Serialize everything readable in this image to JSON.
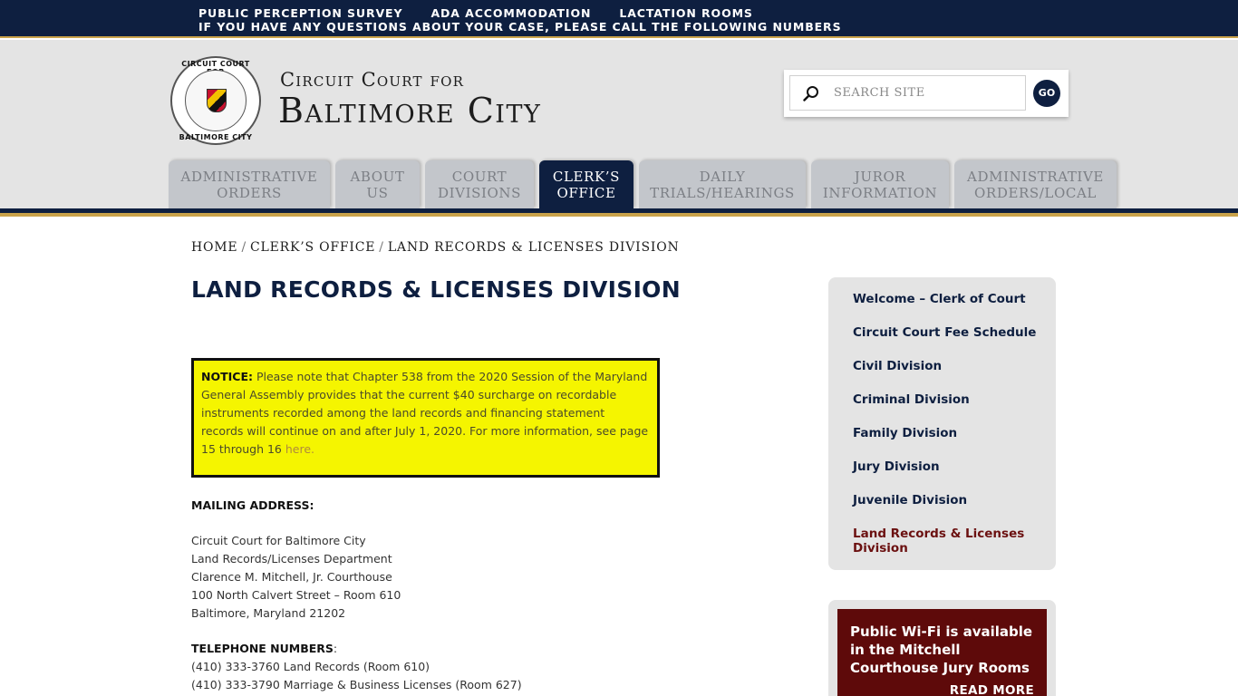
{
  "topbar": {
    "links": [
      "PUBLIC PERCEPTION SURVEY",
      "ADA ACCOMMODATION",
      "LACTATION ROOMS"
    ],
    "notice": "IF YOU HAVE ANY QUESTIONS ABOUT YOUR CASE, PLEASE CALL THE FOLLOWING NUMBERS"
  },
  "header": {
    "title_small": "Circuit Court for",
    "title_big": "Baltimore City",
    "seal_top": "CIRCUIT COURT FOR",
    "seal_bottom": "BALTIMORE CITY",
    "search_placeholder": "SEARCH SITE",
    "go_label": "GO"
  },
  "nav": {
    "tabs": [
      {
        "line1": "ADMINISTRATIVE",
        "line2": "ORDERS"
      },
      {
        "line1": "ABOUT",
        "line2": "US"
      },
      {
        "line1": "COURT",
        "line2": "DIVISIONS"
      },
      {
        "line1": "CLERK’S",
        "line2": "OFFICE"
      },
      {
        "line1": "DAILY",
        "line2": "TRIALS/HEARINGS"
      },
      {
        "line1": "JUROR",
        "line2": "INFORMATION"
      },
      {
        "line1": "ADMINISTRATIVE",
        "line2": "ORDERS/LOCAL"
      }
    ]
  },
  "breadcrumb": {
    "home": "HOME",
    "clerk": "CLERK’S OFFICE",
    "current": "LAND RECORDS & LICENSES DIVISION"
  },
  "page": {
    "title": "LAND RECORDS & LICENSES DIVISION",
    "notice_label": "NOTICE:",
    "notice_text": "Please note that Chapter 538 from the 2020 Session of the Maryland General Assembly provides that the current $40 surcharge on recordable instruments recorded among the land records and financing statement records will continue on and after July 1, 2020. For more information, see page 15 through 16",
    "notice_link": "here.",
    "mailing_label": "MAILING ADDRESS:",
    "address": [
      "Circuit Court for Baltimore City",
      "Land Records/Licenses Department",
      "Clarence M. Mitchell, Jr. Courthouse",
      "100 North Calvert Street – Room 610",
      "Baltimore, Maryland 21202"
    ],
    "phone_label": "TELEPHONE NUMBERS",
    "phone_colon": ":",
    "phones": [
      "(410) 333-3760 Land Records (Room 610)",
      "(410) 333-3790 Marriage & Business Licenses (Room 627)"
    ]
  },
  "sidebar": {
    "items": [
      "Welcome – Clerk of Court",
      "Circuit Court Fee Schedule",
      "Civil Division",
      "Criminal Division",
      "Family Division",
      "Jury Division",
      "Juvenile Division",
      "Land Records & Licenses Division"
    ],
    "promo_text": "Public Wi-Fi is available in the Mitchell Courthouse Jury Rooms",
    "promo_more": "READ MORE"
  }
}
